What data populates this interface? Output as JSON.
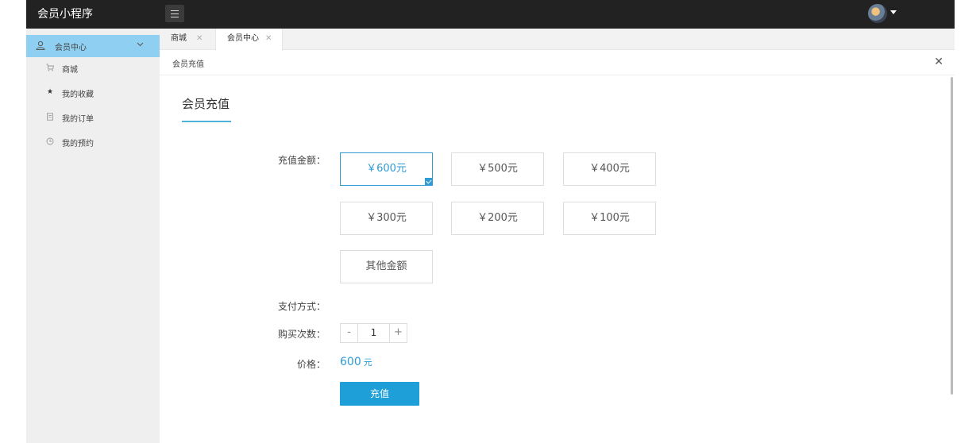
{
  "app": {
    "title": "会员小程序"
  },
  "sidebar": {
    "header": "会员中心",
    "items": [
      {
        "label": "商城",
        "icon": "cart-icon"
      },
      {
        "label": "我的收藏",
        "icon": "star-icon"
      },
      {
        "label": "我的订单",
        "icon": "order-icon"
      },
      {
        "label": "我的预约",
        "icon": "clock-icon"
      }
    ]
  },
  "tabs": [
    {
      "label": "商城",
      "close": "✕"
    },
    {
      "label": "会员中心",
      "close": "✕"
    }
  ],
  "subheader": {
    "title": "会员充值",
    "close": "✕"
  },
  "page": {
    "title": "会员充值",
    "amount_label": "充值金额：",
    "amounts": [
      "￥600元",
      "￥500元",
      "￥400元",
      "￥300元",
      "￥200元",
      "￥100元",
      "其他金额"
    ],
    "selected_amount": "￥600元",
    "payment_label": "支付方式：",
    "quantity_label": "购买次数：",
    "quantity": "1",
    "minus": "-",
    "plus": "+",
    "price_label": "价格：",
    "price_value": "600",
    "price_unit": "元",
    "submit_label": "充值"
  },
  "colors": {
    "accent": "#2f9bd5",
    "topbar": "#222222",
    "sidebar_active": "#8fd0f2"
  }
}
